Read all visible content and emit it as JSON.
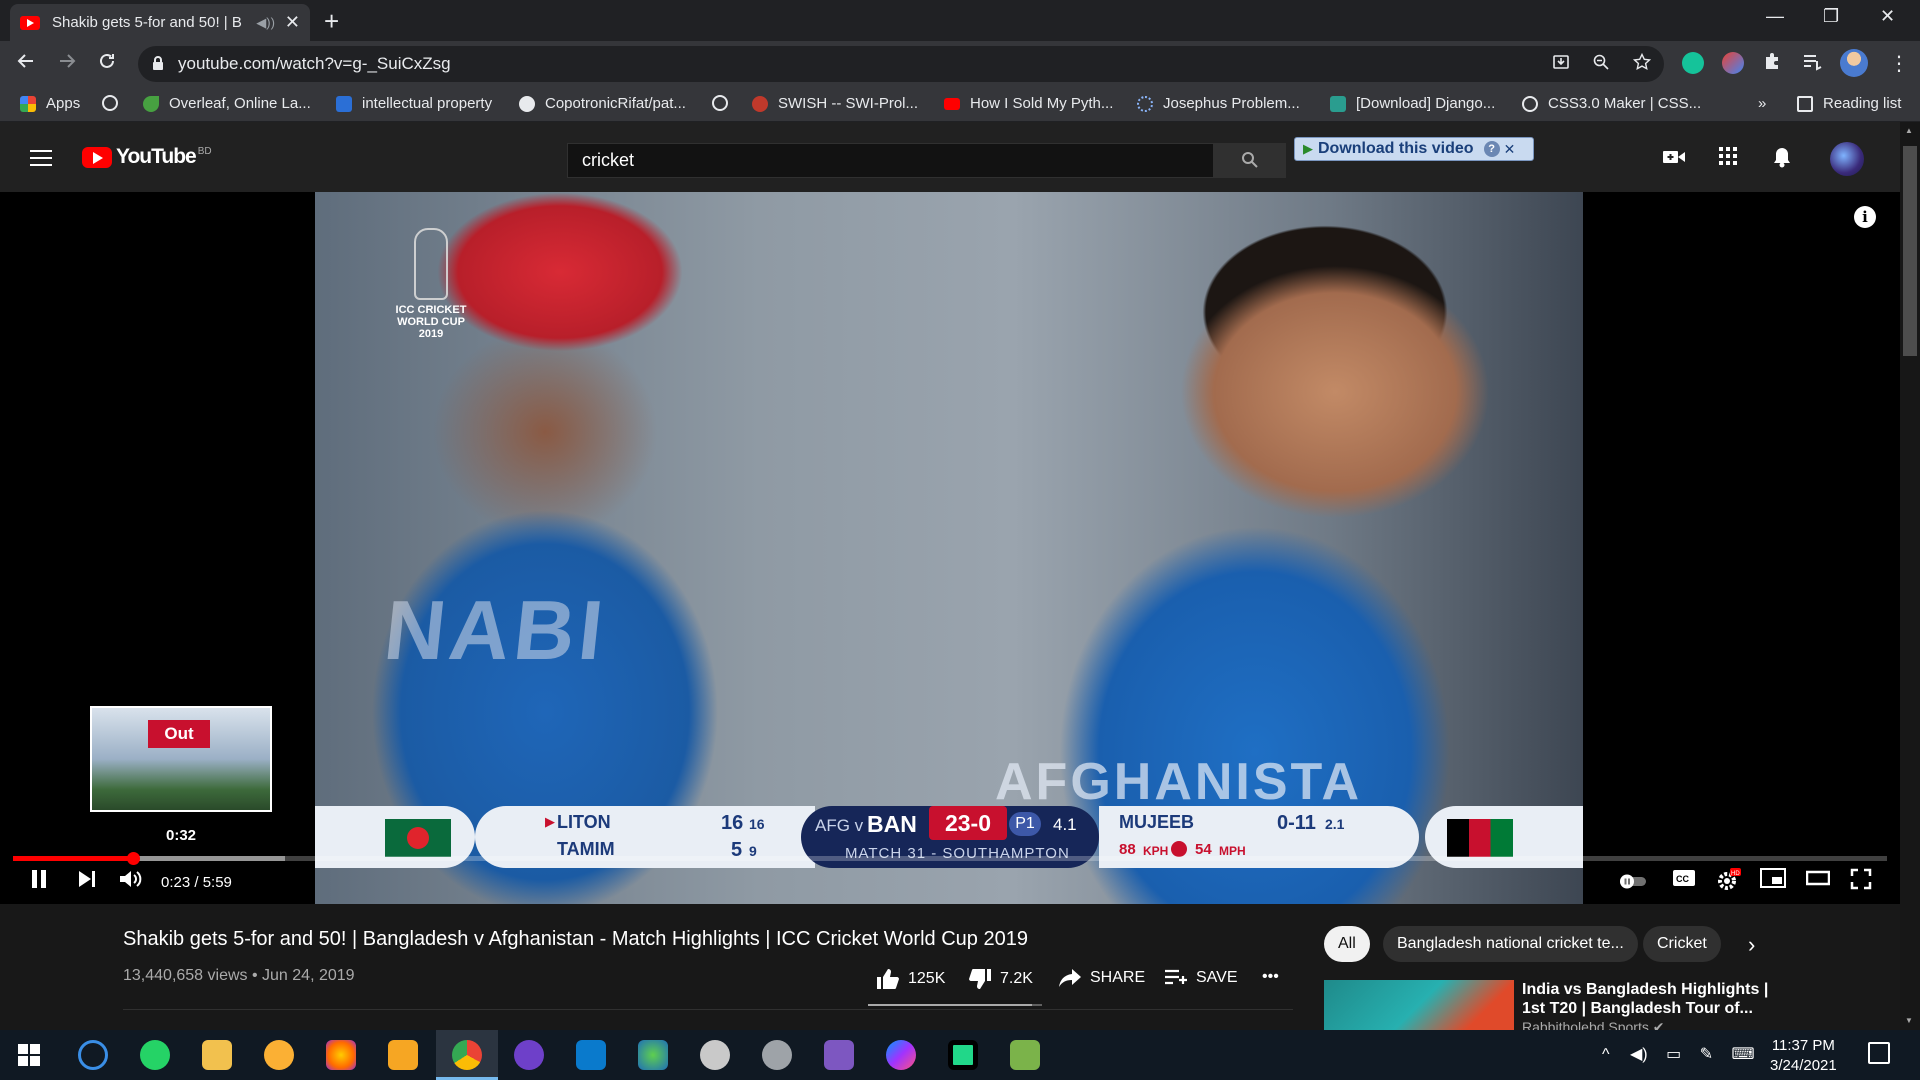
{
  "browser": {
    "tab_title": "Shakib gets 5-for and 50! | B",
    "tab_audio": "◀))",
    "tab_close": "✕",
    "new_tab": "+",
    "url": "youtube.com/watch?v=g-_SuiCxZsg",
    "window_controls": {
      "minimize": "—",
      "restore": "❐",
      "close": "✕"
    },
    "bookmarks": [
      {
        "label": "Apps",
        "icon": "apps-grid-icon",
        "color": "#e8453c"
      },
      {
        "label": "",
        "icon": "globe-icon",
        "color": "#e8eaed"
      },
      {
        "label": "Overleaf, Online La...",
        "icon": "overleaf-icon",
        "color": "#47a141"
      },
      {
        "label": "intellectual property",
        "icon": "s-icon",
        "color": "#2b6fd6"
      },
      {
        "label": "CopotronicRifat/pat...",
        "icon": "github-icon",
        "color": "#e8eaed"
      },
      {
        "label": "",
        "icon": "globe-icon",
        "color": "#e8eaed"
      },
      {
        "label": "SWISH -- SWI-Prol...",
        "icon": "swish-icon",
        "color": "#c0392b"
      },
      {
        "label": "How I Sold My Pyth...",
        "icon": "youtube-icon",
        "color": "#ff0000"
      },
      {
        "label": "Josephus Problem...",
        "icon": "loading-icon",
        "color": "#8ab4f8"
      },
      {
        "label": "[Download] Django...",
        "icon": "django-icon",
        "color": "#2a9d8f"
      },
      {
        "label": "CSS3.0 Maker | CSS...",
        "icon": "globe-icon",
        "color": "#e8eaed"
      }
    ],
    "bookmarks_more": "»",
    "reading_list": "Reading list"
  },
  "youtube": {
    "logo_text": "YouTube",
    "country_code": "BD",
    "search_value": "cricket",
    "download_bar": {
      "label": "Download this video",
      "help": "?",
      "close": "✕"
    }
  },
  "video": {
    "overlay_logo_text": "ICC CRICKET WORLD CUP 2019",
    "jersey_name": "NABI",
    "jersey_country": "AFGHANISTA",
    "scorebar": {
      "batter1": {
        "name": "LITON",
        "runs": "16",
        "balls": "16"
      },
      "batter2": {
        "name": "TAMIM",
        "runs": "5",
        "balls": "9"
      },
      "teams": "AFG v",
      "batting_team": "BAN",
      "score": "23-0",
      "powerplay": "P1",
      "overs": "4.1",
      "match": "MATCH 31 - SOUTHAMPTON",
      "bowler": {
        "name": "MUJEEB",
        "figures": "0-11",
        "overs": "2.1"
      },
      "speed_kph": "88",
      "kph_unit": "KPH",
      "speed_mph": "54",
      "mph_unit": "MPH"
    },
    "preview_badge": "Out",
    "preview_time": "0:32",
    "current_time": "0:23 / 5:59",
    "played_fraction": 0.064,
    "buffered_fraction": 0.145
  },
  "details": {
    "title": "Shakib gets 5-for and 50! | Bangladesh v Afghanistan - Match Highlights | ICC Cricket World Cup 2019",
    "meta": "13,440,658 views • Jun 24, 2019",
    "likes": "125K",
    "dislikes": "7.2K",
    "share": "SHARE",
    "save": "SAVE",
    "more": "•••",
    "like_ratio": 0.945
  },
  "sidebar": {
    "chips": [
      "All",
      "Bangladesh national cricket te...",
      "Cricket"
    ],
    "related_title": "India vs Bangladesh Highlights | 1st T20 | Bangladesh Tour of...",
    "related_channel": "Rabbitholebd Sports ✔"
  },
  "taskbar": {
    "time": "11:37 PM",
    "date": "3/24/2021"
  }
}
